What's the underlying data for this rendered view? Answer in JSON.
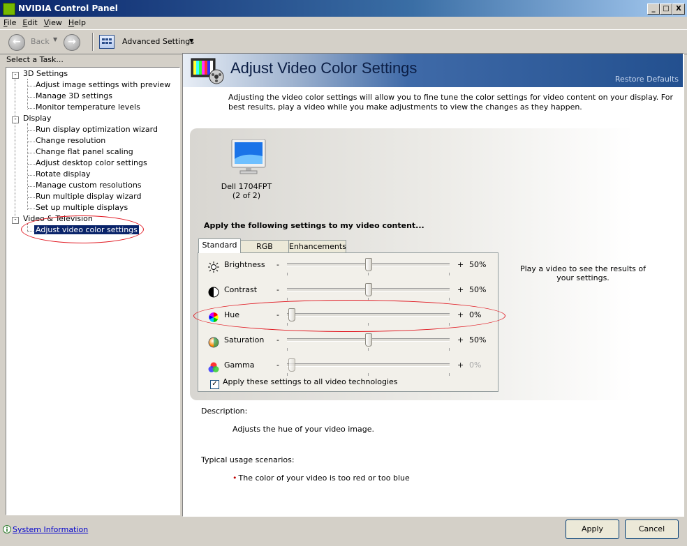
{
  "window": {
    "title": "NVIDIA Control Panel",
    "controls": [
      "_",
      "□",
      "X"
    ]
  },
  "menu": {
    "items": [
      "File",
      "Edit",
      "View",
      "Help"
    ]
  },
  "toolbar": {
    "back_label": "Back",
    "advanced_label": "Advanced Settings"
  },
  "left": {
    "select_task": "Select a Task...",
    "tree": [
      {
        "label": "3D Settings",
        "children": [
          "Adjust image settings with preview",
          "Manage 3D settings",
          "Monitor temperature levels"
        ]
      },
      {
        "label": "Display",
        "children": [
          "Run display optimization wizard",
          "Change resolution",
          "Change flat panel scaling",
          "Adjust desktop color settings",
          "Rotate display",
          "Manage custom resolutions",
          "Run multiple display wizard",
          "Set up multiple displays"
        ]
      },
      {
        "label": "Video & Television",
        "children": [
          "Adjust video color settings"
        ]
      }
    ],
    "tree_toggle": "-",
    "selected_item": "Adjust video color settings",
    "system_info": "System Information"
  },
  "header": {
    "title": "Adjust Video Color Settings",
    "restore": "Restore Defaults"
  },
  "intro": "Adjusting the video color settings will allow you to fine tune the color settings for video content on your display.  For best results, play a video while you make adjustments to view the changes as they happen.",
  "monitor": {
    "name": "Dell 1704FPT",
    "index": "(2 of 2)"
  },
  "apply_label": "Apply the following settings to my video content...",
  "tabs": [
    "Standard",
    "RGB Gamma",
    "Enhancements"
  ],
  "active_tab": "Standard",
  "sliders": [
    {
      "label": "Brightness",
      "minus": "-",
      "plus": "+",
      "value": "50%",
      "level": 0.5,
      "icon": "brightness-icon",
      "enabled": true
    },
    {
      "label": "Contrast",
      "minus": "-",
      "plus": "+",
      "value": "50%",
      "level": 0.5,
      "icon": "contrast-icon",
      "enabled": true
    },
    {
      "label": "Hue",
      "minus": "-",
      "plus": "+",
      "value": "0%",
      "level": 0.0,
      "icon": "hue-icon",
      "enabled": true
    },
    {
      "label": "Saturation",
      "minus": "-",
      "plus": "+",
      "value": "50%",
      "level": 0.5,
      "icon": "saturation-icon",
      "enabled": true
    },
    {
      "label": "Gamma",
      "minus": "-",
      "plus": "+",
      "value": "0%",
      "level": 0.0,
      "icon": "gamma-icon",
      "enabled": false
    }
  ],
  "apply_all": {
    "label": "Apply these settings to all video technologies",
    "checked": true,
    "check_glyph": "✓"
  },
  "play_note": "Play a video to see the results of your settings.",
  "description": {
    "heading": "Description:",
    "text": "Adjusts the hue of your video image."
  },
  "usage": {
    "heading": "Typical usage scenarios:",
    "bullet": "•",
    "item": "The color of your video is too red or too blue"
  },
  "buttons": {
    "apply": "Apply",
    "cancel": "Cancel"
  },
  "colors": {
    "selection": "#0a246a",
    "annotation": "#e0161f",
    "header_dark": "#23508f",
    "link": "#0000cc"
  }
}
